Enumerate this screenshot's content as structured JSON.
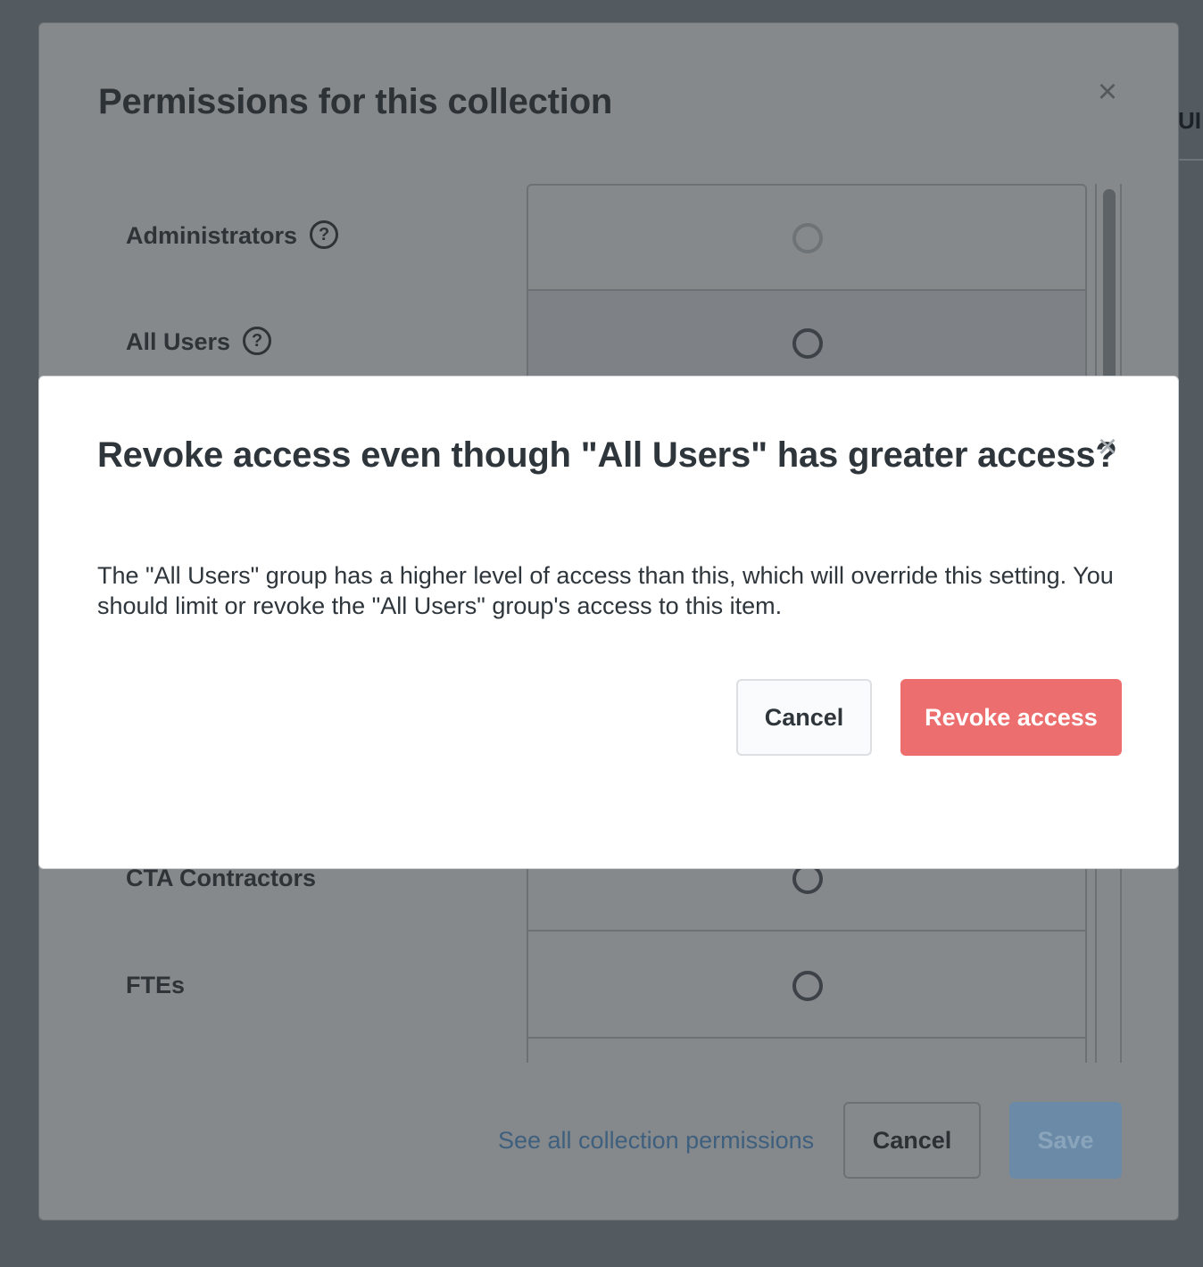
{
  "background": {
    "peek_text": "UI"
  },
  "permissions_modal": {
    "title": "Permissions for this collection",
    "close_glyph": "×",
    "groups": [
      {
        "label": "Administrators",
        "has_help": true
      },
      {
        "label": "All Users",
        "has_help": true
      },
      {
        "label": "CTA Contractors",
        "has_help": false
      },
      {
        "label": "FTEs",
        "has_help": false
      }
    ],
    "help_glyph": "?",
    "see_all_link": "See all collection permissions",
    "cancel_label": "Cancel",
    "save_label": "Save"
  },
  "revoke_dialog": {
    "title": "Revoke access even though \"All Users\" has greater access?",
    "close_glyph": "×",
    "body": "The \"All Users\" group has a higher level of access than this, which will override this setting. You should limit or revoke the \"All Users\" group's access to this item.",
    "cancel_label": "Cancel",
    "confirm_label": "Revoke access",
    "confirm_color": "#ed6e6e"
  }
}
